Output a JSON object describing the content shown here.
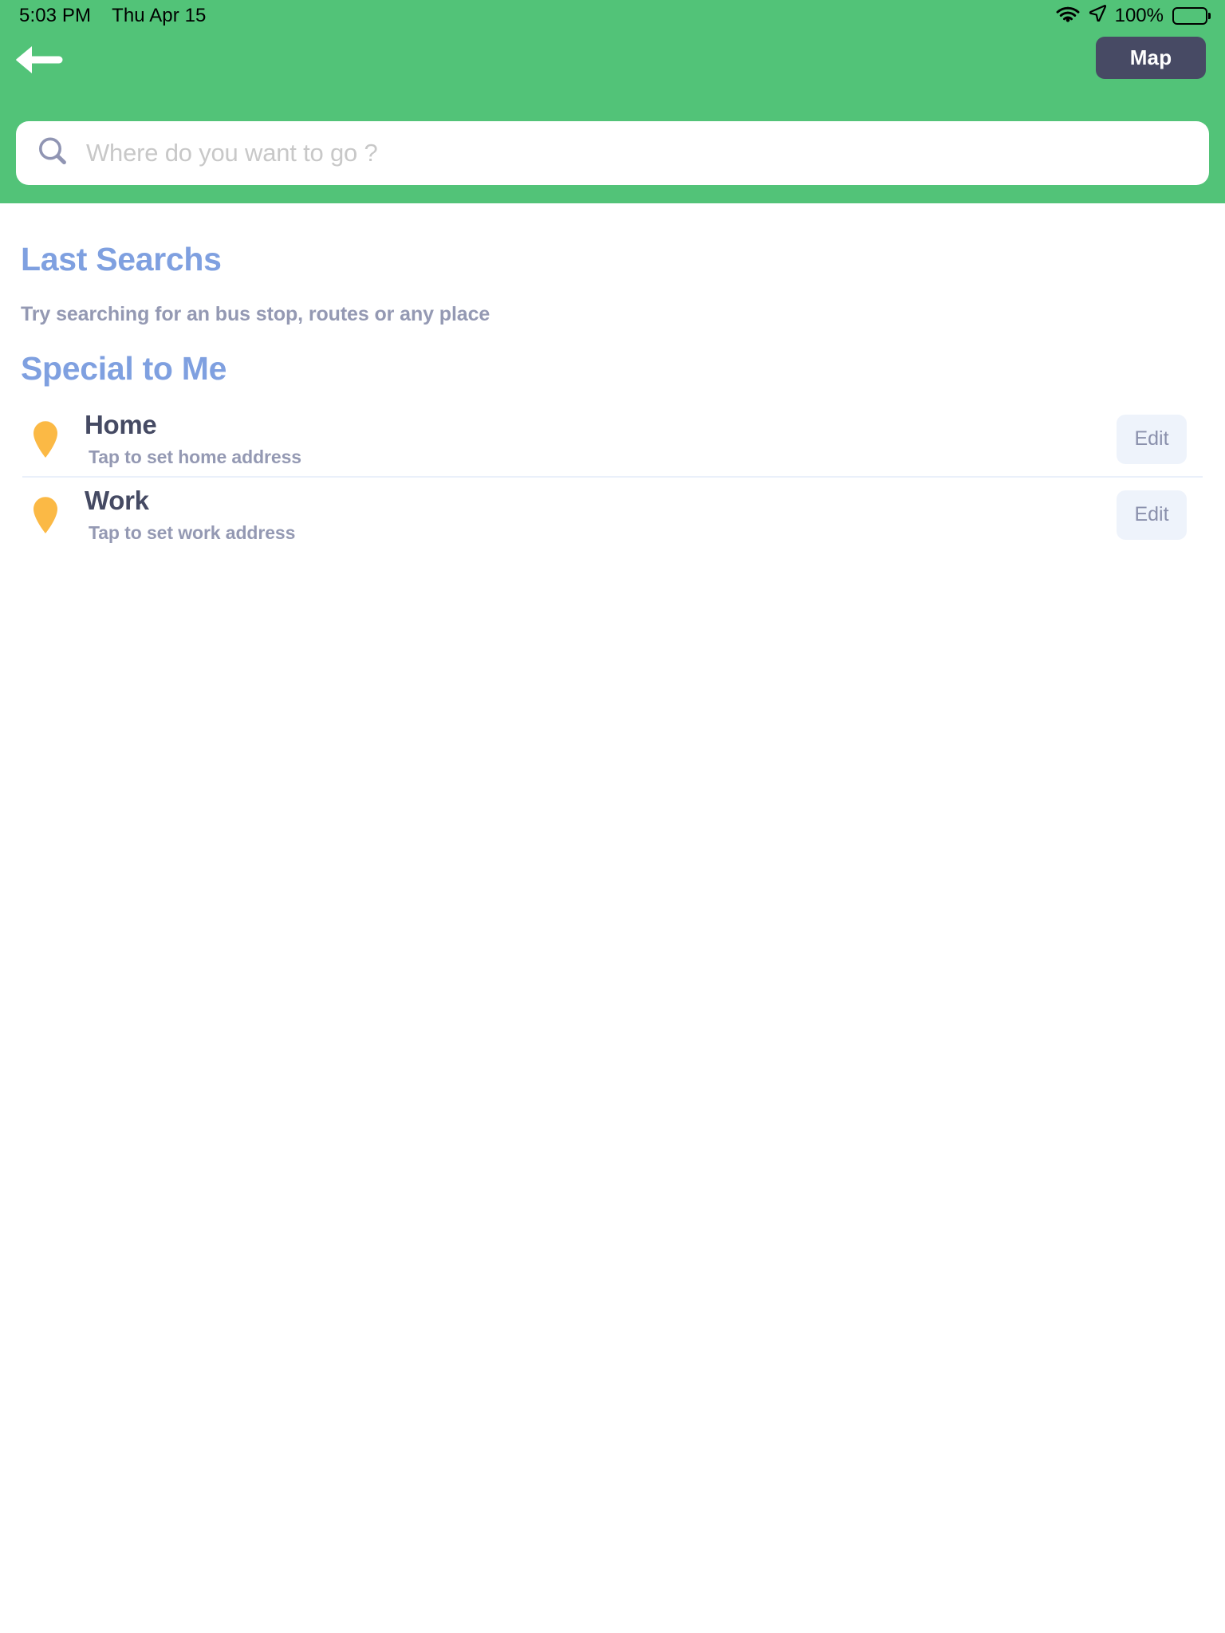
{
  "statusbar": {
    "time": "5:03 PM",
    "date": "Thu Apr 15",
    "battery_percent": "100%",
    "wifi_icon": "wifi-icon",
    "location_icon": "location-arrow-icon",
    "battery_icon": "battery-full-icon"
  },
  "header": {
    "background_color": "#52c378",
    "back_icon": "back-arrow-icon",
    "map_label": "Map",
    "map_button_color": "#474a64"
  },
  "search": {
    "placeholder": "Where do you want to go ?",
    "value": "",
    "icon": "search-icon"
  },
  "last_searches": {
    "title": "Last Searchs",
    "subtitle": "Try searching for an bus stop, routes or any place",
    "accent_color": "#7fa0e0"
  },
  "special": {
    "title": "Special to Me",
    "items": [
      {
        "name": "Home",
        "subtitle": "Tap to set home address",
        "edit_label": "Edit",
        "pin_icon": "map-pin-icon",
        "pin_color": "#fbb945"
      },
      {
        "name": "Work",
        "subtitle": "Tap to set work address",
        "edit_label": "Edit",
        "pin_icon": "map-pin-icon",
        "pin_color": "#fbb945"
      }
    ]
  }
}
